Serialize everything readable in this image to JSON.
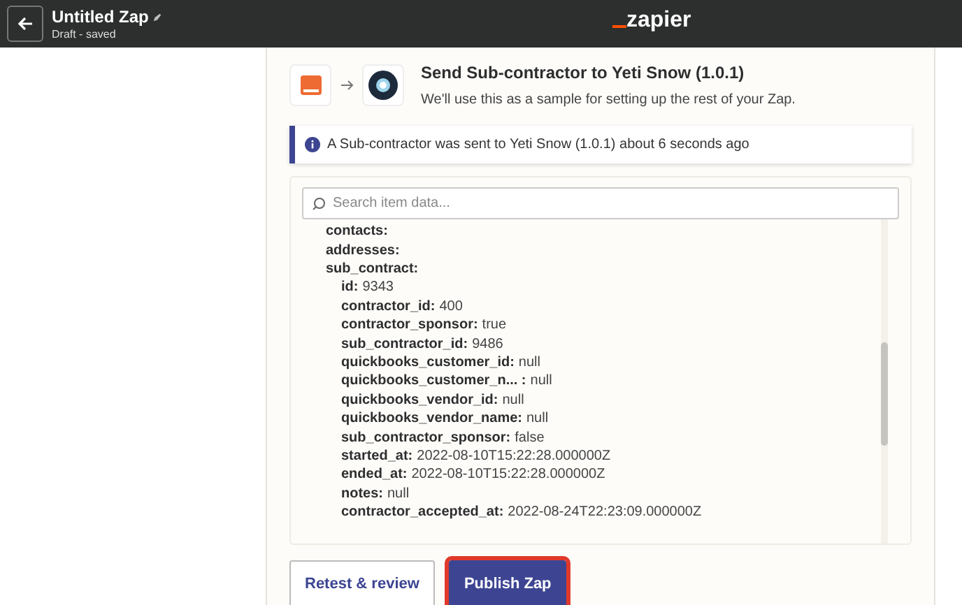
{
  "header": {
    "title": "Untitled Zap",
    "subtitle": "Draft - saved",
    "logo": "zapier"
  },
  "step": {
    "title": "Send Sub-contractor to Yeti Snow (1.0.1)",
    "description": "We'll use this as a sample for setting up the rest of your Zap."
  },
  "banner": {
    "text": "A Sub-contractor was sent to Yeti Snow (1.0.1) about 6 seconds ago"
  },
  "search": {
    "placeholder": "Search item data..."
  },
  "items": [
    {
      "key": "contacts:"
    },
    {
      "key": "addresses:"
    },
    {
      "key": "sub_contract:",
      "children": [
        {
          "key": "id:",
          "value": "9343"
        },
        {
          "key": "contractor_id:",
          "value": "400"
        },
        {
          "key": "contractor_sponsor:",
          "value": "true"
        },
        {
          "key": "sub_contractor_id:",
          "value": "9486"
        },
        {
          "key": "quickbooks_customer_id:",
          "value": "null"
        },
        {
          "key": "quickbooks_customer_n...  :",
          "value": "null"
        },
        {
          "key": "quickbooks_vendor_id:",
          "value": "null"
        },
        {
          "key": "quickbooks_vendor_name:",
          "value": "null"
        },
        {
          "key": "sub_contractor_sponsor:",
          "value": "false"
        },
        {
          "key": "started_at:",
          "value": "2022-08-10T15:22:28.000000Z"
        },
        {
          "key": "ended_at:",
          "value": "2022-08-10T15:22:28.000000Z"
        },
        {
          "key": "notes:",
          "value": "null"
        },
        {
          "key": "contractor_accepted_at:",
          "value": "2022-08-24T22:23:09.000000Z"
        }
      ]
    }
  ],
  "buttons": [
    {
      "label": "Retest & review",
      "kind": "secondary",
      "highlighted": false
    },
    {
      "label": "Publish Zap",
      "kind": "primary",
      "highlighted": true
    }
  ]
}
